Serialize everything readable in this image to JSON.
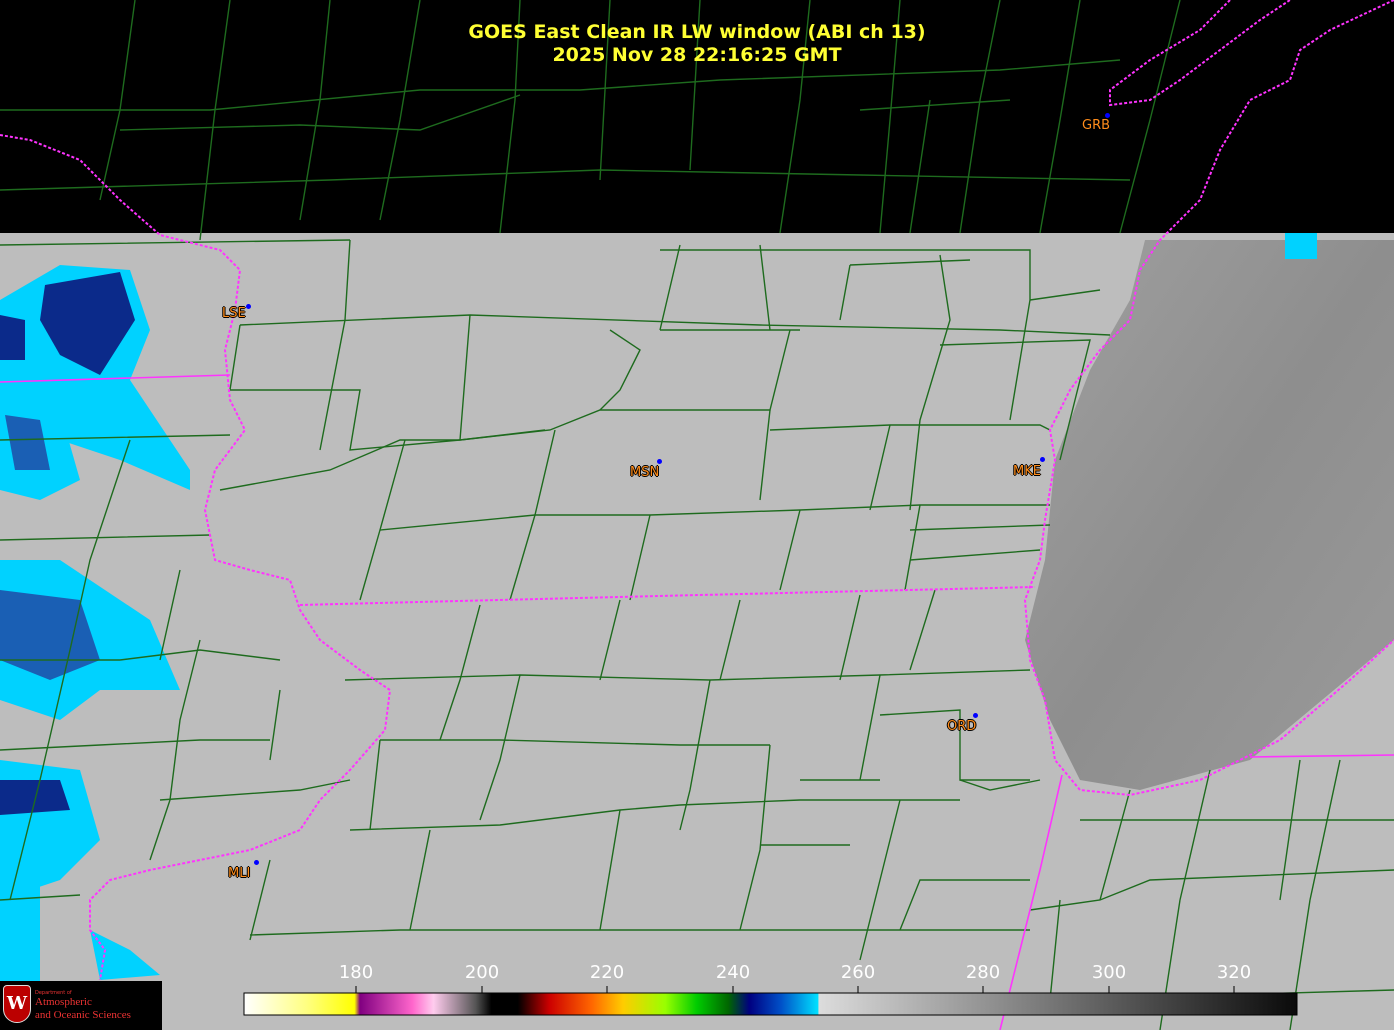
{
  "title": {
    "line1": "GOES East Clean IR LW window (ABI ch 13)",
    "line2": "2025 Nov 28  22:16:25 GMT"
  },
  "stations": [
    {
      "id": "lse",
      "label": "LSE"
    },
    {
      "id": "msn",
      "label": "MSN"
    },
    {
      "id": "mke",
      "label": "MKE"
    },
    {
      "id": "grb",
      "label": "GRB"
    },
    {
      "id": "ord",
      "label": "ORD"
    },
    {
      "id": "mli",
      "label": "MLI"
    }
  ],
  "colorbar": {
    "ticks": [
      "180",
      "200",
      "220",
      "240",
      "260",
      "280",
      "300",
      "320"
    ],
    "range": [
      163,
      330
    ]
  },
  "logo": {
    "dept": "Department of",
    "line1": "Atmospheric",
    "line2": "and Oceanic Sciences",
    "seal_letter": "W"
  },
  "colors": {
    "title": "#ffff33",
    "county_lines": "#1e6b1e",
    "state_lines": "#ff33ff",
    "station_label": "#ff8c1a",
    "station_marker": "#0000ff",
    "cloud_cold": "#00d2ff",
    "cloud_colder": "#0b2a8a"
  }
}
